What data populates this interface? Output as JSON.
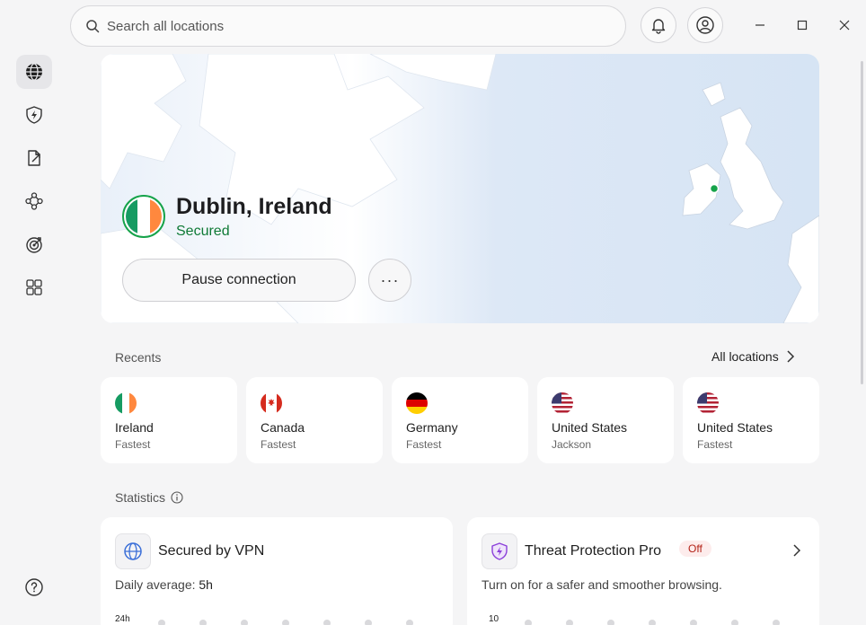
{
  "search": {
    "placeholder": "Search all locations"
  },
  "connection": {
    "location": "Dublin, Ireland",
    "status": "Secured",
    "pause_label": "Pause connection",
    "more_label": "···"
  },
  "recents": {
    "label": "Recents",
    "all_label": "All locations",
    "items": [
      {
        "country": "Ireland",
        "detail": "Fastest",
        "flag": "ireland-flag-icon"
      },
      {
        "country": "Canada",
        "detail": "Fastest",
        "flag": "canada-flag-icon"
      },
      {
        "country": "Germany",
        "detail": "Fastest",
        "flag": "germany-flag-icon"
      },
      {
        "country": "United States",
        "detail": "Jackson",
        "flag": "us-flag-icon"
      },
      {
        "country": "United States",
        "detail": "Fastest",
        "flag": "us-flag-icon"
      }
    ]
  },
  "statistics": {
    "label": "Statistics",
    "vpn": {
      "title": "Secured by VPN",
      "daily_label": "Daily average:",
      "daily_value": "5h",
      "axis_top": "24h"
    },
    "threat": {
      "title": "Threat Protection Pro",
      "badge": "Off",
      "subtitle": "Turn on for a safer and smoother browsing.",
      "axis_top": "10"
    }
  },
  "colors": {
    "secured": "#0f7a36",
    "accent_green": "#16a34a",
    "off_badge": "#b42318",
    "map_water": "#dce8f6",
    "map_land": "#ffffff"
  },
  "icons": {
    "sidebar": [
      "globe-icon",
      "shield-bolt-icon",
      "split-tunnel-icon",
      "meshnet-icon",
      "target-icon",
      "apps-grid-icon",
      "help-icon"
    ],
    "top": [
      "search-icon",
      "bell-icon",
      "account-icon",
      "minimize-icon",
      "maximize-icon",
      "close-icon"
    ]
  }
}
